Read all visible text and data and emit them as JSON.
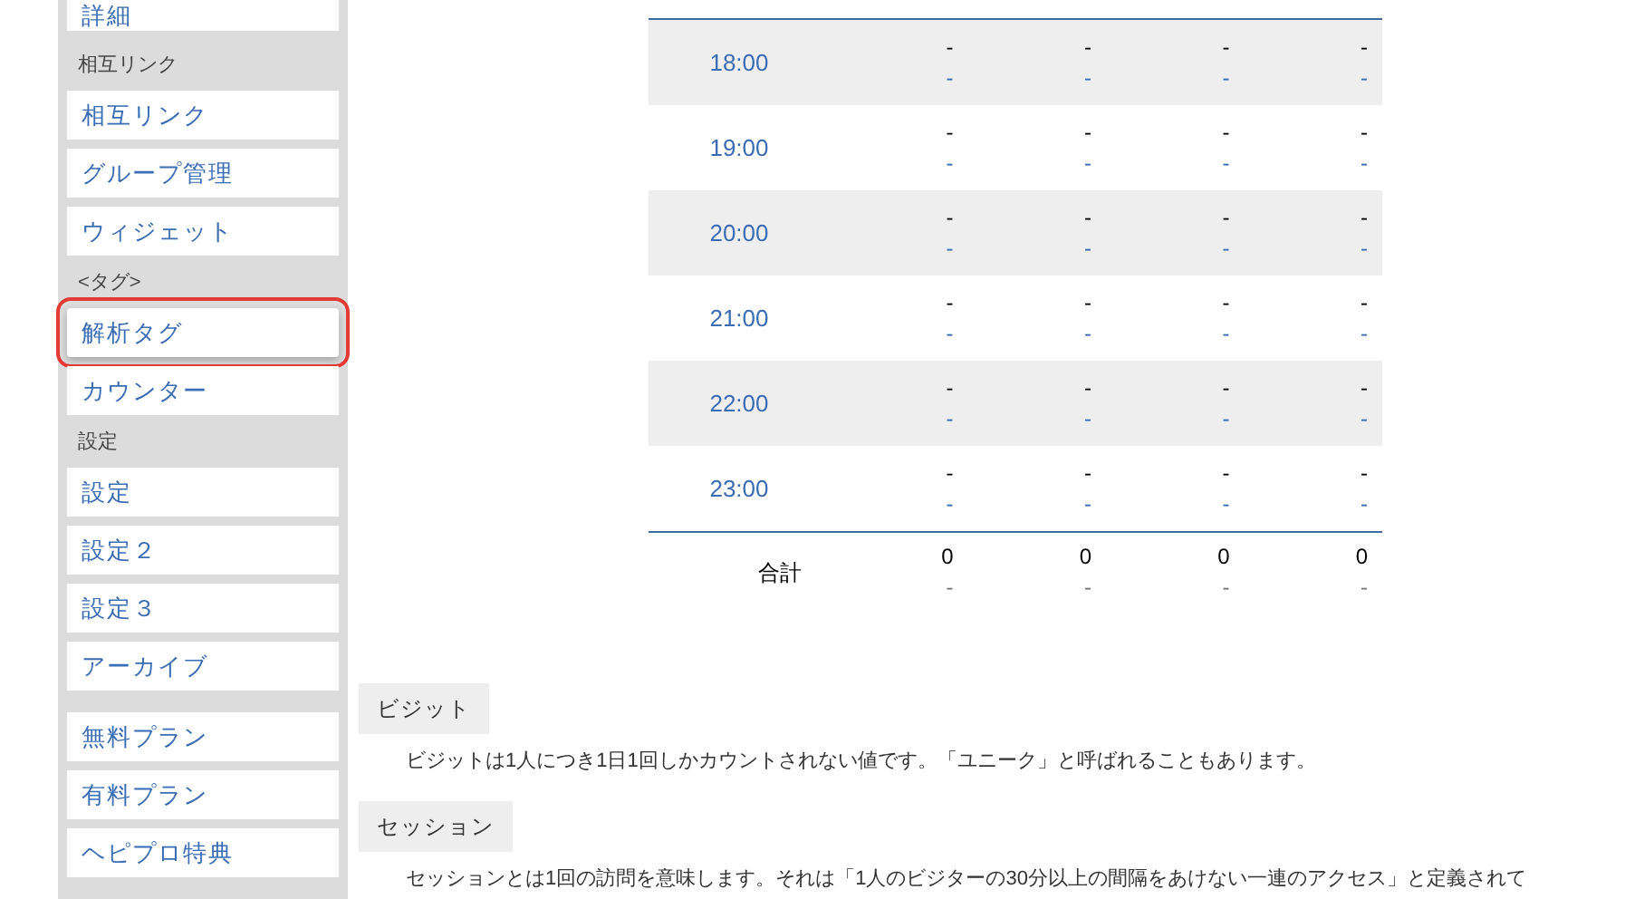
{
  "sidebar": {
    "sections": [
      {
        "items": [
          {
            "label": "詳細",
            "highlighted": false
          }
        ]
      },
      {
        "heading": "相互リンク",
        "items": [
          {
            "label": "相互リンク",
            "highlighted": false
          },
          {
            "label": "グループ管理",
            "highlighted": false
          },
          {
            "label": "ウィジェット",
            "highlighted": false
          }
        ]
      },
      {
        "heading": "<タグ>",
        "items": [
          {
            "label": "解析タグ",
            "highlighted": true
          },
          {
            "label": "カウンター",
            "highlighted": false
          }
        ]
      },
      {
        "heading": "設定",
        "items": [
          {
            "label": "設定",
            "highlighted": false
          },
          {
            "label": "設定２",
            "highlighted": false
          },
          {
            "label": "設定３",
            "highlighted": false
          },
          {
            "label": "アーカイブ",
            "highlighted": false
          }
        ]
      },
      {
        "items": [
          {
            "label": "無料プラン",
            "highlighted": false
          },
          {
            "label": "有料プラン",
            "highlighted": false
          },
          {
            "label": "ヘピプロ特典",
            "highlighted": false
          }
        ]
      }
    ]
  },
  "table": {
    "rows": [
      {
        "time": "18:00",
        "cells": [
          [
            "-",
            "-"
          ],
          [
            "-",
            "-"
          ],
          [
            "-",
            "-"
          ],
          [
            "-",
            "-"
          ]
        ]
      },
      {
        "time": "19:00",
        "cells": [
          [
            "-",
            "-"
          ],
          [
            "-",
            "-"
          ],
          [
            "-",
            "-"
          ],
          [
            "-",
            "-"
          ]
        ]
      },
      {
        "time": "20:00",
        "cells": [
          [
            "-",
            "-"
          ],
          [
            "-",
            "-"
          ],
          [
            "-",
            "-"
          ],
          [
            "-",
            "-"
          ]
        ]
      },
      {
        "time": "21:00",
        "cells": [
          [
            "-",
            "-"
          ],
          [
            "-",
            "-"
          ],
          [
            "-",
            "-"
          ],
          [
            "-",
            "-"
          ]
        ]
      },
      {
        "time": "22:00",
        "cells": [
          [
            "-",
            "-"
          ],
          [
            "-",
            "-"
          ],
          [
            "-",
            "-"
          ],
          [
            "-",
            "-"
          ]
        ]
      },
      {
        "time": "23:00",
        "cells": [
          [
            "-",
            "-"
          ],
          [
            "-",
            "-"
          ],
          [
            "-",
            "-"
          ],
          [
            "-",
            "-"
          ]
        ]
      }
    ],
    "total": {
      "label": "合計",
      "cells": [
        [
          "0",
          "-"
        ],
        [
          "0",
          "-"
        ],
        [
          "0",
          "-"
        ],
        [
          "0",
          "-"
        ]
      ]
    }
  },
  "glossary": [
    {
      "term": "ビジット",
      "text": "ビジットは1人につき1日1回しかカウントされない値です。「ユニーク」と呼ばれることもあります。"
    },
    {
      "term": "セッション",
      "text": "セッションとは1回の訪問を意味します。それは「1人のビジターの30分以上の間隔をあけない一連のアクセス」と定義されて"
    }
  ]
}
